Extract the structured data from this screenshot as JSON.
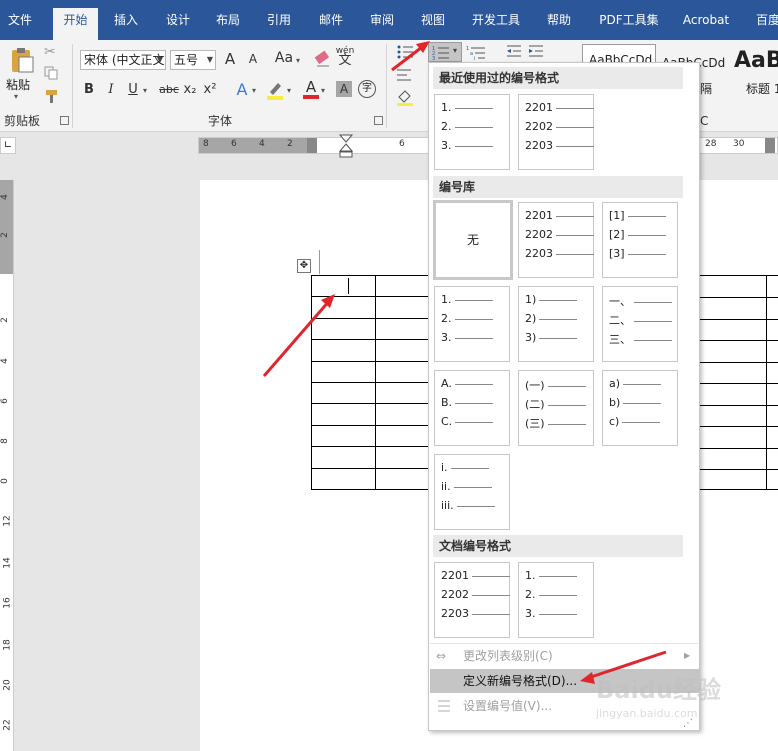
{
  "tabs": [
    {
      "label": "文件"
    },
    {
      "label": "开始"
    },
    {
      "label": "插入"
    },
    {
      "label": "设计"
    },
    {
      "label": "布局"
    },
    {
      "label": "引用"
    },
    {
      "label": "邮件"
    },
    {
      "label": "审阅"
    },
    {
      "label": "视图"
    },
    {
      "label": "开发工具"
    },
    {
      "label": "帮助"
    },
    {
      "label": "PDF工具集"
    },
    {
      "label": "Acrobat"
    },
    {
      "label": "百度"
    }
  ],
  "ribbon": {
    "clipboard": {
      "paste_label": "粘贴",
      "group_label": "剪贴板"
    },
    "font": {
      "font_name": "宋体 (中文正文",
      "font_size": "五号",
      "group_label": "字体"
    },
    "font_buttons": {
      "grow": "A",
      "shrink": "A",
      "change_case": "Aa",
      "bold": "B",
      "italic": "I",
      "underline": "U",
      "strike": "abc",
      "subscript": "x₂",
      "superscript": "x²",
      "text_effect": "A",
      "font_color": "A",
      "char_shade": "A",
      "enclose": "字",
      "phonetic": "wén"
    },
    "styles": [
      {
        "preview": "AaBbCcDd",
        "name": ""
      },
      {
        "preview": "AaBbCcDd",
        "name": "隔"
      },
      {
        "preview": "AaB",
        "name": "标题 1"
      }
    ],
    "styles_group_label": "C"
  },
  "ruler": {
    "h_left": [
      "8",
      "6",
      "4",
      "2"
    ],
    "h_mid": [
      "6"
    ],
    "h_right": [
      "28",
      "30"
    ],
    "v": [
      "4",
      "2",
      "2",
      "4",
      "6",
      "8",
      "0",
      "12",
      "14",
      "16",
      "18",
      "20",
      "22"
    ]
  },
  "numbering_menu": {
    "recent_header": "最近使用过的编号格式",
    "recent": [
      {
        "lines": [
          "1.",
          "2.",
          "3."
        ]
      },
      {
        "lines": [
          "2201",
          "2202",
          "2203"
        ]
      }
    ],
    "library_header": "编号库",
    "library_none": "无",
    "library": [
      {
        "lines": [
          "2201",
          "2202",
          "2203"
        ]
      },
      {
        "lines": [
          "[1]",
          "[2]",
          "[3]"
        ]
      },
      {
        "lines": [
          "1.",
          "2.",
          "3."
        ]
      },
      {
        "lines": [
          "1)",
          "2)",
          "3)"
        ]
      },
      {
        "lines": [
          "一、",
          "二、",
          "三、"
        ]
      },
      {
        "lines": [
          "A.",
          "B.",
          "C."
        ]
      },
      {
        "lines": [
          "(一)",
          "(二)",
          "(三)"
        ]
      },
      {
        "lines": [
          "a)",
          "b)",
          "c)"
        ]
      },
      {
        "lines": [
          "i.",
          "ii.",
          "iii."
        ]
      }
    ],
    "doc_header": "文档编号格式",
    "doc": [
      {
        "lines": [
          "2201",
          "2202",
          "2203"
        ]
      },
      {
        "lines": [
          "1.",
          "2.",
          "3."
        ]
      }
    ],
    "items": {
      "change_level": "更改列表级别(C)",
      "define_new": "定义新编号格式(D)...",
      "set_value": "设置编号值(V)..."
    }
  },
  "watermark": {
    "text": "Baidu经验",
    "sub": "jingyan.baidu.com"
  },
  "colors": {
    "tab_bg": "#2b579a",
    "ribbon_bg": "#f3f3f3",
    "arrow": "#e0262b",
    "highlight": "#c5c5c5"
  }
}
